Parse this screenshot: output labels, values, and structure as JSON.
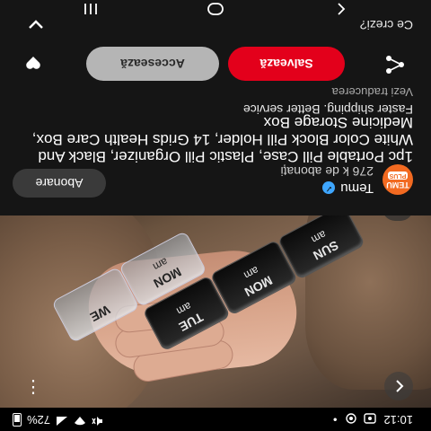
{
  "status_bar": {
    "time": "10:12",
    "battery": "72%"
  },
  "video": {
    "pill_labels": [
      "TUE",
      "MON",
      "SUN",
      "MON",
      "WE"
    ],
    "pill_sub": "am"
  },
  "channel": {
    "name": "Temu",
    "avatar_text": "TEMU",
    "avatar_badge": "PLUS",
    "subscribers": "276 k de abonați",
    "subscribe_label": "Abonare"
  },
  "product": {
    "title": "1pc Portable Pill Case, Plastic Pill Organizer, Black And White Color Block Pill Holder, 14 Grids Health Care Box, Medicine Storage Box",
    "promo": "Faster shipping. Better service",
    "translate_label": "Vezi traducerea"
  },
  "actions": {
    "save_label": "Salvează",
    "visit_label": "Accesează"
  },
  "comments": {
    "prompt": "Ce crezi?"
  },
  "colors": {
    "accent_red": "#e3001b",
    "temu_orange": "#f26a21",
    "verified_blue": "#3ea6ff"
  }
}
